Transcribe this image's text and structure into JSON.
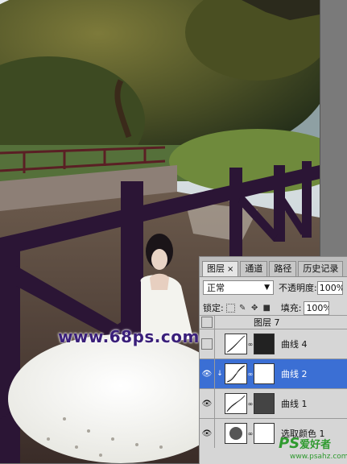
{
  "tabs": [
    {
      "label": "图层",
      "close": "×"
    },
    {
      "label": "通道"
    },
    {
      "label": "路径"
    },
    {
      "label": "历史记录"
    }
  ],
  "blend_mode": "正常",
  "opacity_label": "不透明度:",
  "opacity_value": "100%",
  "lock_label": "锁定:",
  "fill_label": "填充:",
  "fill_value": "100%",
  "layers": [
    {
      "name": "图层 7",
      "visible": false
    },
    {
      "name": "曲线 4",
      "visible": false
    },
    {
      "name": "曲线 2",
      "visible": true,
      "selected": true
    },
    {
      "name": "曲线 1",
      "visible": true
    },
    {
      "name": "选取颜色 1",
      "visible": true
    }
  ],
  "watermark": "www.68ps.com",
  "logo": {
    "ps": "PS",
    "cn": "爱好者",
    "url": "www.psahz.com"
  },
  "colors": {
    "selection": "#3b6fd4",
    "watermark": "#3a1f7a",
    "logo": "#2f9a2f"
  },
  "icons": [
    "eye-icon",
    "link-icon",
    "lock-transparent-icon",
    "lock-brush-icon",
    "lock-move-icon",
    "lock-all-icon",
    "curves-thumbnail-icon",
    "clip-arrow-icon"
  ]
}
